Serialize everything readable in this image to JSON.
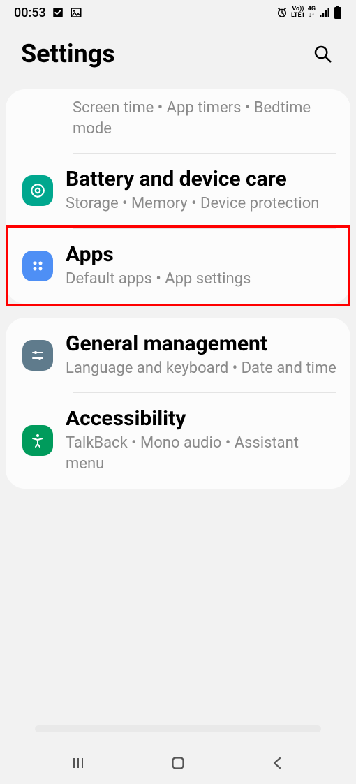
{
  "status": {
    "time": "00:53",
    "indicators": {
      "volte": "Vo))",
      "lte": "LTE1",
      "net": "4G"
    }
  },
  "header": {
    "title": "Settings"
  },
  "group1": {
    "digital_wellbeing_sub": "Screen time  •  App timers  •  Bedtime mode",
    "battery_title": "Battery and device care",
    "battery_sub": "Storage  •  Memory  •  Device protection",
    "apps_title": "Apps",
    "apps_sub": "Default apps  •  App settings"
  },
  "group2": {
    "gm_title": "General management",
    "gm_sub": "Language and keyboard  •  Date and time",
    "acc_title": "Accessibility",
    "acc_sub": "TalkBack  •  Mono audio  •  Assistant menu"
  },
  "highlight_target": "apps"
}
